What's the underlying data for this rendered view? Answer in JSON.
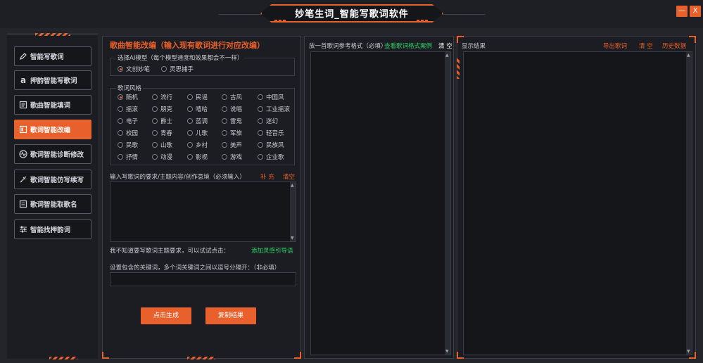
{
  "window": {
    "title": "妙笔生词_智能写歌词软件",
    "minimize_label": "—",
    "close_label": "X"
  },
  "sidebar": {
    "items": [
      {
        "label": "智能写歌词",
        "icon": "pen-icon"
      },
      {
        "label": "押韵智能写歌词",
        "icon": "rhyme-icon"
      },
      {
        "label": "歌曲智能填词",
        "icon": "document-icon"
      },
      {
        "label": "歌词智能改编",
        "icon": "rewrite-icon"
      },
      {
        "label": "歌词智能诊断修改",
        "icon": "diagnosis-icon"
      },
      {
        "label": "歌词智能仿写续写",
        "icon": "quill-icon"
      },
      {
        "label": "歌词智能取歌名",
        "icon": "title-icon"
      },
      {
        "label": "智能找押韵词",
        "icon": "sliders-icon"
      }
    ],
    "active_index": 3
  },
  "left_panel": {
    "title": "歌曲智能改编（输入现有歌词进行对应改编）",
    "model_group": {
      "label": "选择AI模型（每个模型速度和效果都会不一样）",
      "options": [
        "文创妙笔",
        "灵思捕手"
      ],
      "selected": 0
    },
    "style_group": {
      "label": "歌词风格",
      "options": [
        "随机",
        "流行",
        "民谣",
        "古风",
        "中国风",
        "摇滚",
        "朋克",
        "嘻哈",
        "说唱",
        "工业摇滚",
        "电子",
        "爵士",
        "蓝调",
        "雷鬼",
        "迷幻",
        "校园",
        "青春",
        "儿歌",
        "军旅",
        "轻音乐",
        "民歌",
        "山歌",
        "乡村",
        "美声",
        "民族风",
        "抒情",
        "动漫",
        "影视",
        "游戏",
        "企业歌"
      ],
      "selected": 0
    },
    "requirement_label": "输入写歌词的要求/主题内容/创作意境（必须输入）",
    "requirement_example": "补 充",
    "requirement_clear": "清空",
    "requirement_value": "",
    "hint_text": "我不知道要写歌词主题要求，可以试试点击：",
    "hint_link": "添加灵感引导语",
    "keywords_label": "设置包含的关键词，多个词关键词之间以逗号分隔开：（非必填）",
    "keywords_value": "",
    "generate_button": "点击生成",
    "copy_button": "复制结果"
  },
  "middle_panel": {
    "header": "放一首歌词参考格式（必填）",
    "sample_link": "查看歌词格式案例",
    "clear_label": "清 空",
    "value": ""
  },
  "right_panel": {
    "header": "显示结果",
    "link_lyrics": "导出歌词",
    "link_clear": "清 空",
    "link_history": "历史数据",
    "value": ""
  }
}
